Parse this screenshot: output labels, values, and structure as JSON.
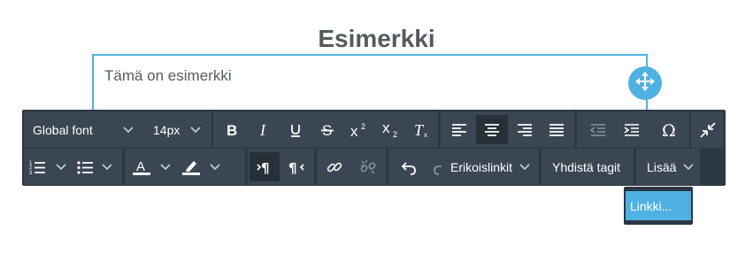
{
  "page": {
    "heading": "Esimerkki",
    "editor_text": "Tämä on esimerkki"
  },
  "toolbar": {
    "font_family": "Global font",
    "font_size": "14px",
    "special_links": "Erikoislinkit",
    "merge_tags": "Yhdistä tagit",
    "more": "Lisää"
  },
  "dropdown": {
    "items": [
      "Linkki..."
    ]
  },
  "colors": {
    "toolbar_bg": "#2b3743",
    "button_bg": "#3a4653",
    "accent": "#4fb1e3",
    "text": "#555a5f"
  },
  "icons": [
    "bold-icon",
    "italic-icon",
    "underline-icon",
    "strikethrough-icon",
    "superscript-icon",
    "subscript-icon",
    "clear-format-icon",
    "align-left-icon",
    "align-center-icon",
    "align-right-icon",
    "align-justify-icon",
    "outdent-icon",
    "indent-icon",
    "omega-icon",
    "collapse-icon",
    "ordered-list-icon",
    "unordered-list-icon",
    "text-color-icon",
    "highlight-icon",
    "ltr-icon",
    "rtl-icon",
    "link-icon",
    "unlink-icon",
    "undo-icon",
    "redo-icon",
    "move-icon"
  ]
}
